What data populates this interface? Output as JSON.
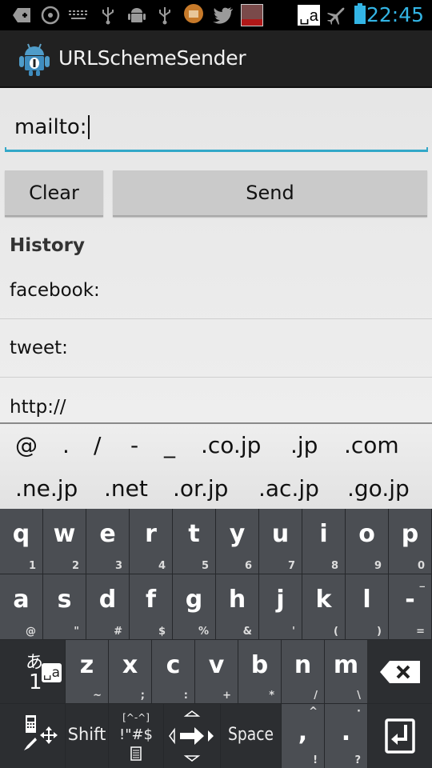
{
  "status_bar": {
    "icons": [
      "add-notification-icon",
      "circle-target-icon",
      "keyboard-icon",
      "usb-icon",
      "android-debug-icon",
      "usb-icon",
      "folder-app-icon",
      "twitter-icon",
      "photo-app-icon",
      "ime-icon",
      "airplane-mode-icon",
      "battery-icon"
    ],
    "ime_label": "␣a",
    "time": "22:45",
    "time_color": "#33b5e5"
  },
  "action_bar": {
    "app_icon": "android-robot-icon",
    "title": "URLSchemeSender"
  },
  "url_input": {
    "value": "mailto:",
    "accent_color": "#33a8c8"
  },
  "buttons": {
    "clear_label": "Clear",
    "send_label": "Send"
  },
  "history": {
    "title": "History",
    "items": [
      "facebook:",
      "tweet:",
      "http://"
    ]
  },
  "suggestions": {
    "row1": [
      "@",
      ".",
      "/",
      "-",
      "_",
      ".co.jp",
      ".jp",
      ".com"
    ],
    "row2": [
      ".ne.jp",
      ".net",
      ".or.jp",
      ".ac.jp",
      ".go.jp"
    ]
  },
  "keyboard": {
    "row1": [
      {
        "main": "q",
        "sub": "1"
      },
      {
        "main": "w",
        "sub": "2"
      },
      {
        "main": "e",
        "sub": "3"
      },
      {
        "main": "r",
        "sub": "4"
      },
      {
        "main": "t",
        "sub": "5"
      },
      {
        "main": "y",
        "sub": "6"
      },
      {
        "main": "u",
        "sub": "7"
      },
      {
        "main": "i",
        "sub": "8"
      },
      {
        "main": "o",
        "sub": "9"
      },
      {
        "main": "p",
        "sub": "0"
      }
    ],
    "row2": [
      {
        "main": "a",
        "sub": "@"
      },
      {
        "main": "s",
        "sub": "\""
      },
      {
        "main": "d",
        "sub": "#"
      },
      {
        "main": "f",
        "sub": "$"
      },
      {
        "main": "g",
        "sub": "%"
      },
      {
        "main": "h",
        "sub": "&"
      },
      {
        "main": "j",
        "sub": "'"
      },
      {
        "main": "k",
        "sub": "("
      },
      {
        "main": "l",
        "sub": ")"
      },
      {
        "main": "-",
        "sub": "=",
        "sup": "_"
      }
    ],
    "row3": [
      {
        "main": "z",
        "sub": "~"
      },
      {
        "main": "x",
        "sub": ";"
      },
      {
        "main": "c",
        "sub": ":"
      },
      {
        "main": "v",
        "sub": "+"
      },
      {
        "main": "b",
        "sub": "*"
      },
      {
        "main": "n",
        "sub": "/"
      },
      {
        "main": "m",
        "sub": "\\"
      }
    ],
    "mode_key": {
      "kana": "あ",
      "num": "1",
      "ime": "␣a"
    },
    "backspace_icon": "backspace-icon",
    "row4": {
      "settings_icon": "phone-edit-move-icon",
      "shift_label": "Shift",
      "symbol_top": "[^-^]",
      "symbol_main": "!\"#$",
      "symbol_icon": "document-icon",
      "cursor_icon": "cursor-arrows-icon",
      "space_label": "Space",
      "comma": {
        "main": ",",
        "sup": "^",
        "sub": "!"
      },
      "period": {
        "main": ".",
        "sup": "·",
        "sub": "?"
      },
      "enter_icon": "enter-icon"
    }
  }
}
